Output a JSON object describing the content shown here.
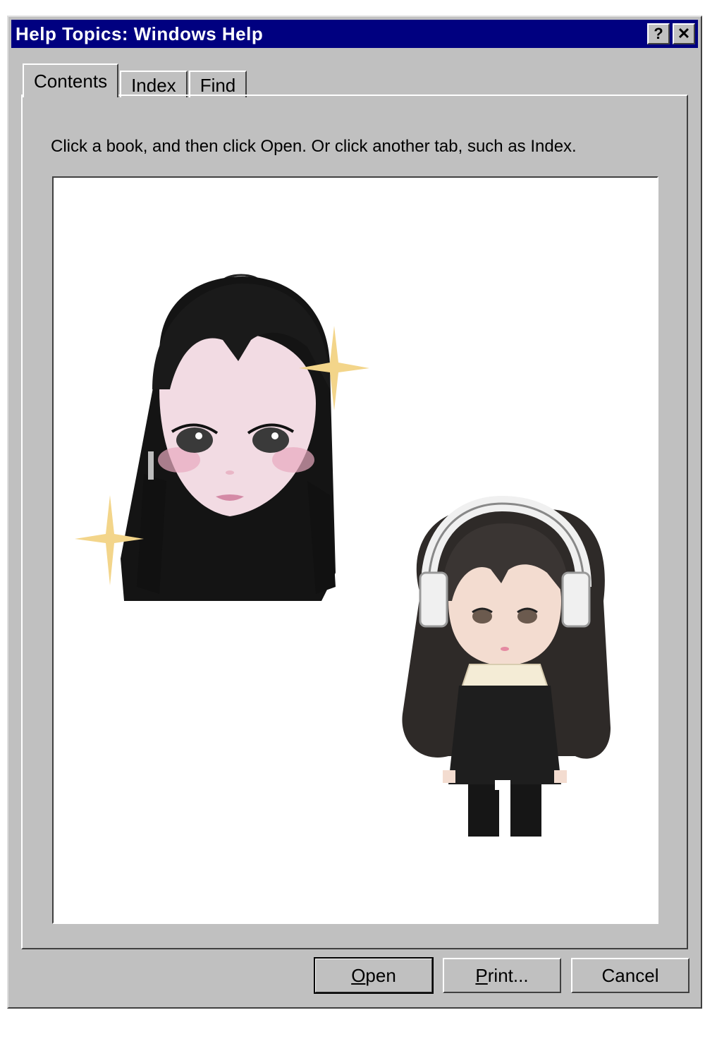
{
  "window": {
    "title": "Help Topics: Windows Help",
    "help_glyph": "?",
    "close_glyph": "✕"
  },
  "tabs": [
    {
      "label": "Contents",
      "active": true
    },
    {
      "label": "Index",
      "active": false
    },
    {
      "label": "Find",
      "active": false
    }
  ],
  "instruction": "Click a book, and then click Open. Or click another tab, such as Index.",
  "buttons": {
    "open": {
      "accel": "O",
      "rest": "pen"
    },
    "print": {
      "accel": "P",
      "rest": "rint..."
    },
    "cancel": {
      "label": "Cancel"
    }
  },
  "colors": {
    "titlebar": "#000080",
    "face": "#c0c0c0",
    "sparkle": "#f3d58a"
  },
  "illustrations": [
    "girl-head-illustration",
    "chibi-girl-with-headphones-illustration",
    "sparkle-icon"
  ]
}
